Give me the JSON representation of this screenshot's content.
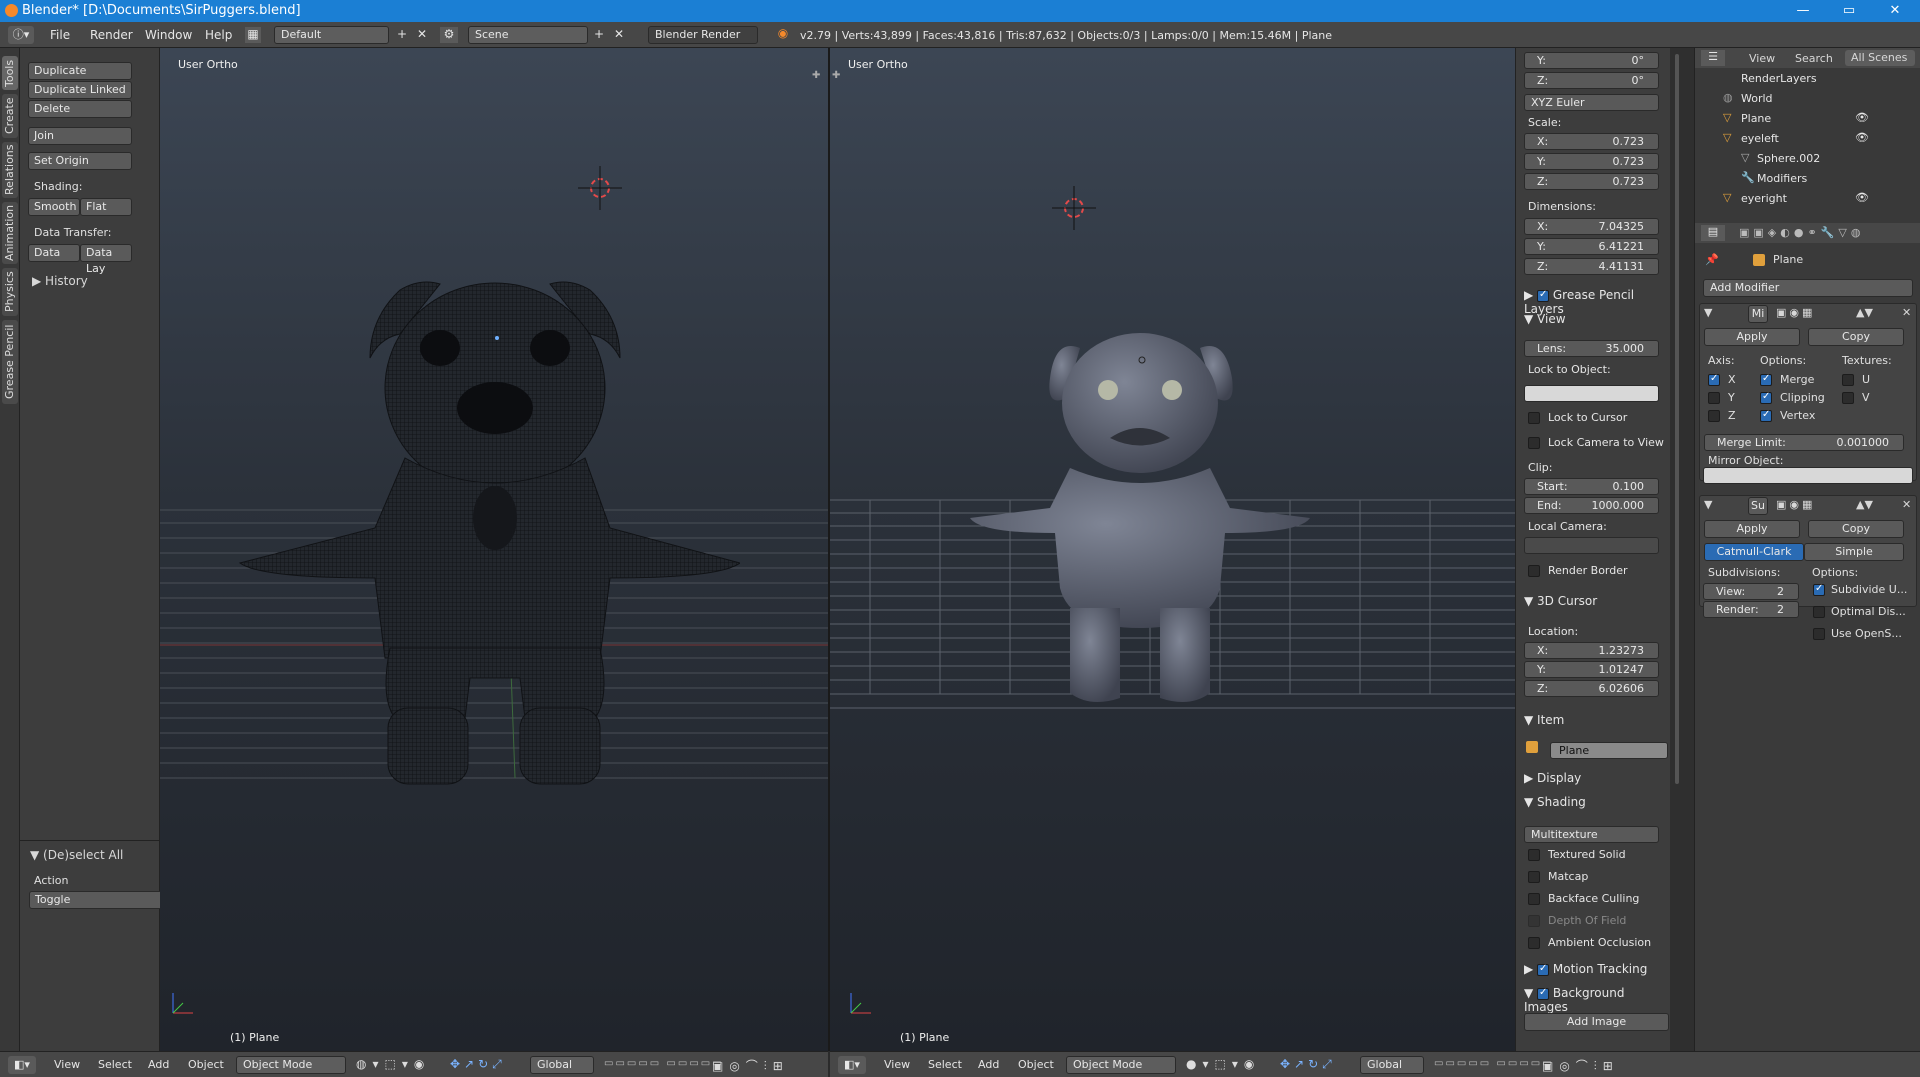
{
  "window": {
    "title": "Blender* [D:\\Documents\\SirPuggers.blend]",
    "minimize": "—",
    "maximize": "▭",
    "close": "✕"
  },
  "info": {
    "menus": [
      "File",
      "Render",
      "Window",
      "Help"
    ],
    "layout": "Default",
    "scene": "Scene",
    "engine": "Blender Render",
    "stats": "v2.79 | Verts:43,899 | Faces:43,816 | Tris:87,632 | Objects:0/3 | Lamps:0/0 | Mem:15.46M | Plane"
  },
  "sidetabs": [
    "Tools",
    "Create",
    "Relations",
    "Animation",
    "Physics",
    "Grease Pencil"
  ],
  "toolshelf": {
    "duplicate": "Duplicate",
    "duplicate_linked": "Duplicate Linked",
    "delete": "Delete",
    "join": "Join",
    "set_origin": "Set Origin",
    "shading_label": "Shading:",
    "smooth": "Smooth",
    "flat": "Flat",
    "data_transfer_label": "Data Transfer:",
    "data": "Data",
    "data_lay": "Data Lay",
    "history": "History",
    "deselect_all": "(De)select All",
    "action_label": "Action",
    "action_value": "Toggle"
  },
  "viewport_left": {
    "label": "User Ortho",
    "object": "(1) Plane"
  },
  "viewport_right": {
    "label": "User Ortho",
    "object": "(1) Plane"
  },
  "npanel": {
    "rot_y": {
      "l": "Y:",
      "v": "0°"
    },
    "rot_z": {
      "l": "Z:",
      "v": "0°"
    },
    "rot_mode": "XYZ Euler",
    "scale_label": "Scale:",
    "scale": [
      {
        "l": "X:",
        "v": "0.723"
      },
      {
        "l": "Y:",
        "v": "0.723"
      },
      {
        "l": "Z:",
        "v": "0.723"
      }
    ],
    "dim_label": "Dimensions:",
    "dims": [
      {
        "l": "X:",
        "v": "7.04325"
      },
      {
        "l": "Y:",
        "v": "6.41221"
      },
      {
        "l": "Z:",
        "v": "4.41131"
      }
    ],
    "grease_pencil": "Grease Pencil Layers",
    "view_head": "View",
    "lens": {
      "l": "Lens:",
      "v": "35.000"
    },
    "lock_object": "Lock to Object:",
    "lock_cursor": "Lock to Cursor",
    "lock_camera": "Lock Camera to View",
    "clip": "Clip:",
    "clip_start": {
      "l": "Start:",
      "v": "0.100"
    },
    "clip_end": {
      "l": "End:",
      "v": "1000.000"
    },
    "local_camera": "Local Camera:",
    "render_border": "Render Border",
    "cursor_head": "3D Cursor",
    "location": "Location:",
    "cursor": [
      {
        "l": "X:",
        "v": "1.23273"
      },
      {
        "l": "Y:",
        "v": "1.01247"
      },
      {
        "l": "Z:",
        "v": "6.02606"
      }
    ],
    "item_head": "Item",
    "item_name": "Plane",
    "display_head": "Display",
    "shading_head": "Shading",
    "shading_mode": "Multitexture",
    "textured_solid": "Textured Solid",
    "matcap": "Matcap",
    "backface": "Backface Culling",
    "dof": "Depth Of Field",
    "ao": "Ambient Occlusion",
    "motion_tracking": "Motion Tracking",
    "bg_images": "Background Images",
    "add_image": "Add Image"
  },
  "outliner": {
    "view": "View",
    "search": "Search",
    "scope": "All Scenes",
    "rows": [
      "RenderLayers",
      "World",
      "Plane",
      "eyeleft",
      "Sphere.002",
      "Modifiers",
      "eyeright"
    ]
  },
  "props": {
    "object": "Plane",
    "add_modifier": "Add Modifier",
    "mirror": {
      "short": "Mi",
      "apply": "Apply",
      "copy": "Copy",
      "axis": "Axis:",
      "options": "Options:",
      "textures": "Textures:",
      "x": "X",
      "y": "Y",
      "z": "Z",
      "merge": "Merge",
      "clipping": "Clipping",
      "vertex": "Vertex",
      "u": "U",
      "v": "V",
      "merge_limit_l": "Merge Limit:",
      "merge_limit_v": "0.001000",
      "mirror_object": "Mirror Object:"
    },
    "subsurf": {
      "short": "Su",
      "apply": "Apply",
      "copy": "Copy",
      "catmull": "Catmull-Clark",
      "simple": "Simple",
      "subdivisions": "Subdivisions:",
      "options": "Options:",
      "view_l": "View:",
      "view_v": "2",
      "render_l": "Render:",
      "render_v": "2",
      "subdivide_uv": "Subdivide U...",
      "optimal": "Optimal Dis...",
      "opensubdiv": "Use OpenS..."
    }
  },
  "bottom": {
    "menus": [
      "View",
      "Select",
      "Add",
      "Object"
    ],
    "mode": "Object Mode",
    "orientation": "Global"
  }
}
